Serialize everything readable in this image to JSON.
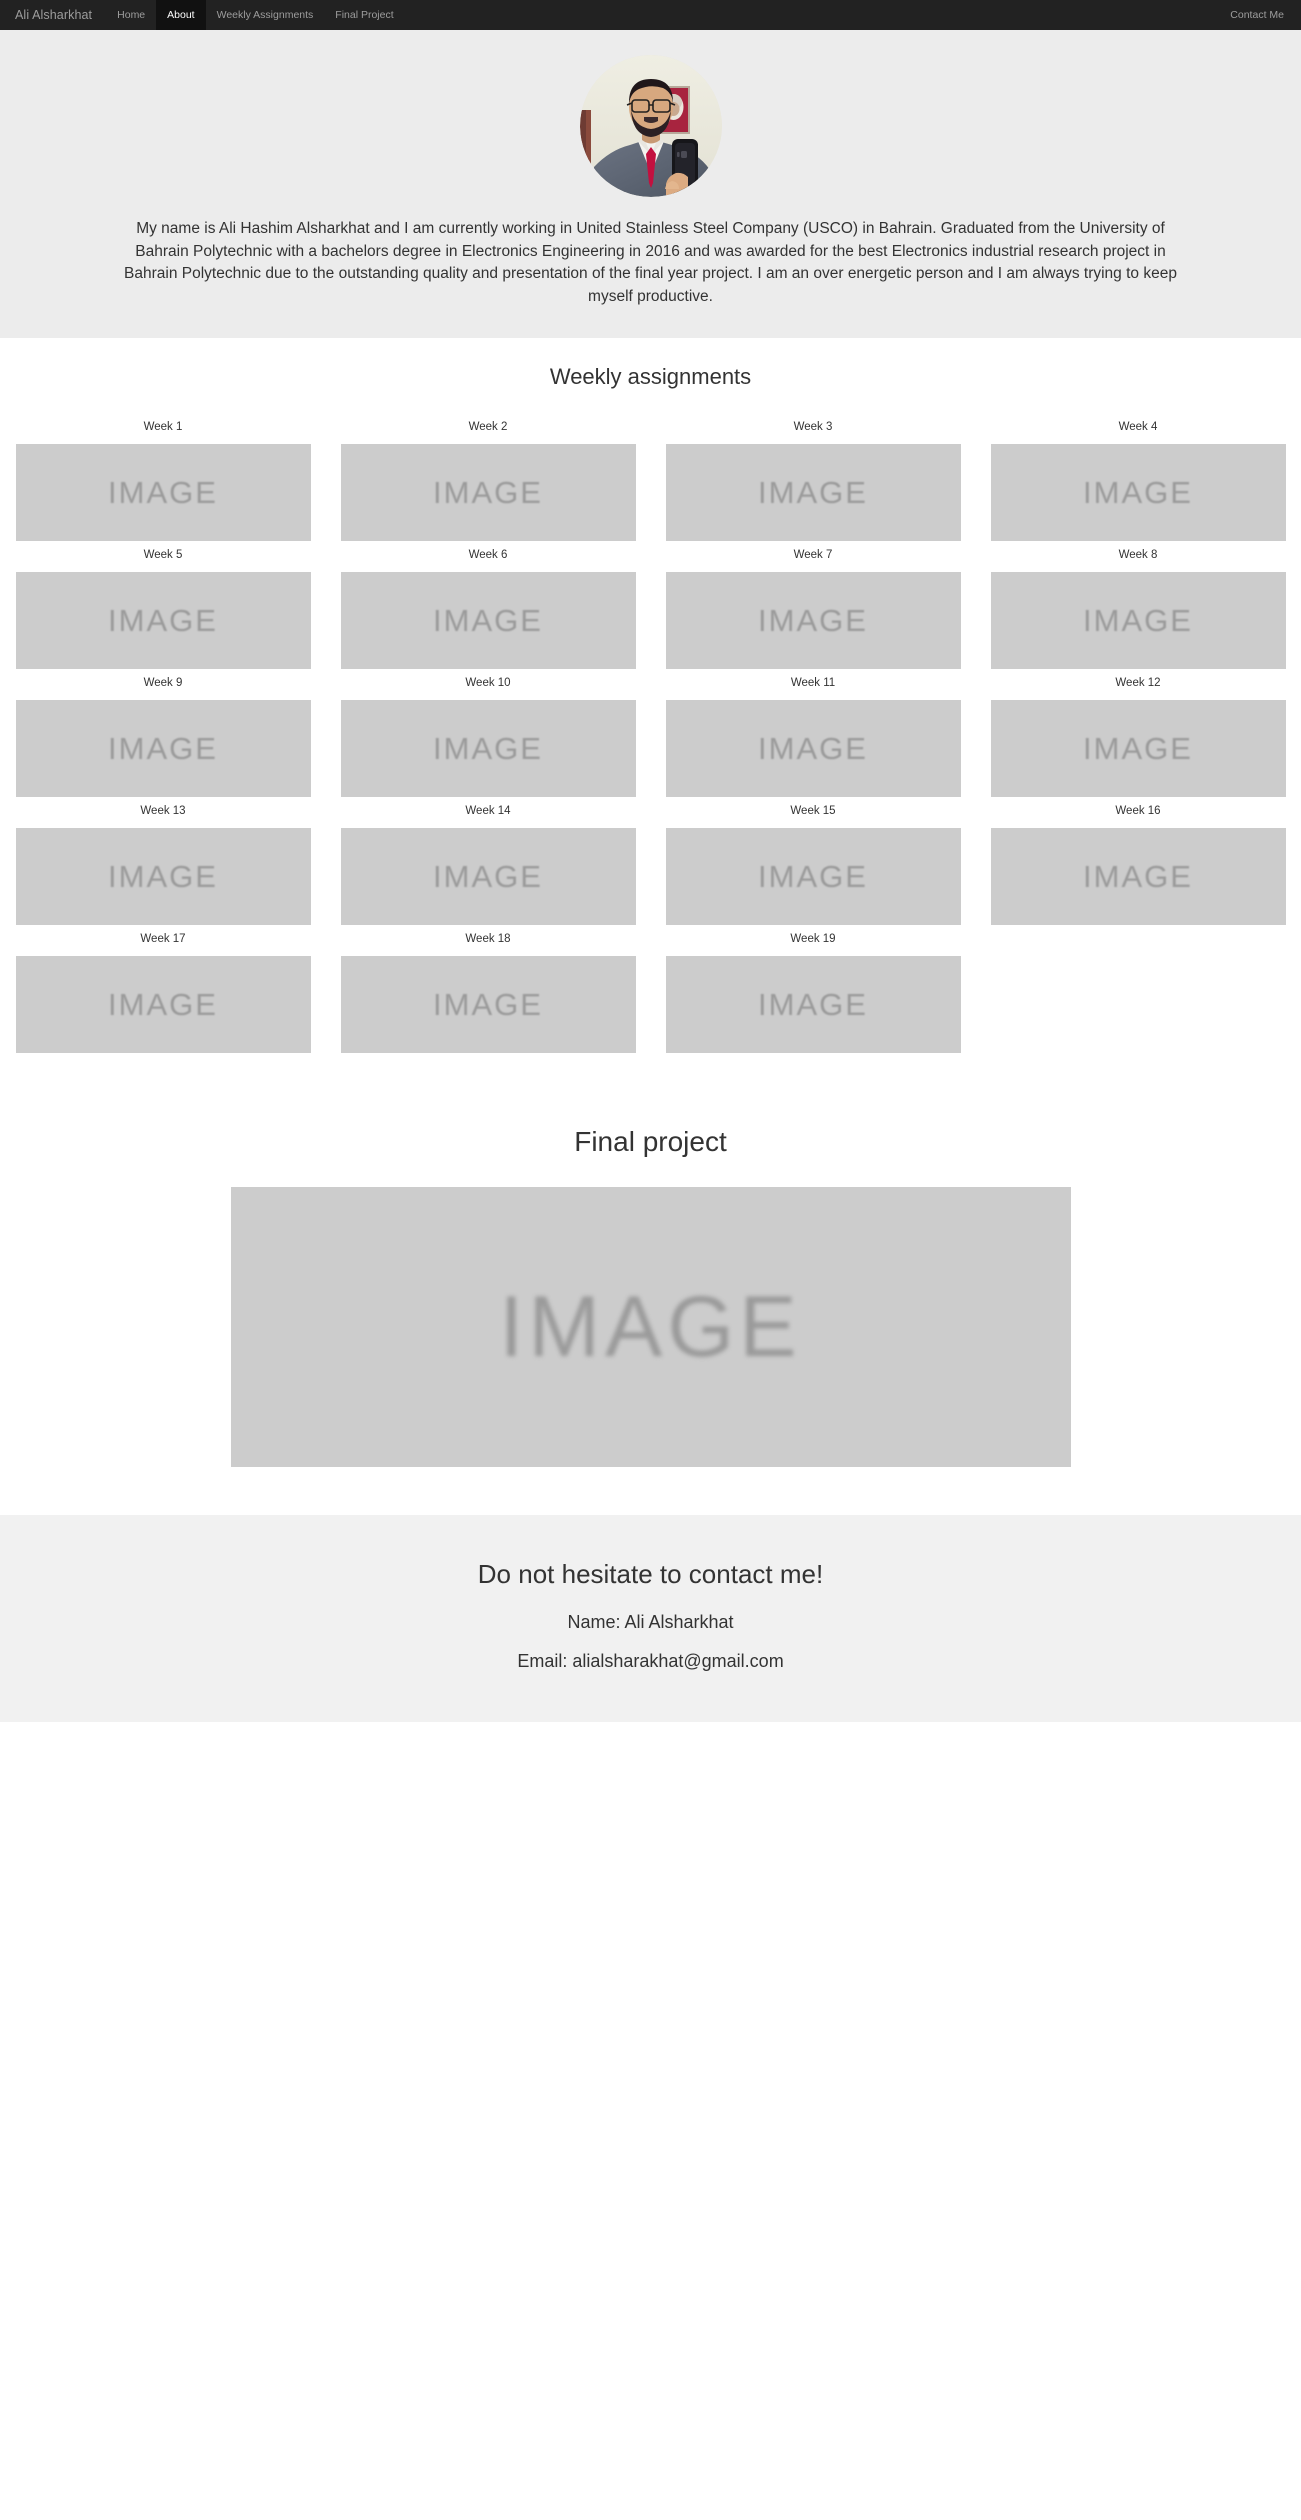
{
  "navbar": {
    "brand": "Ali Alsharkhat",
    "links": [
      {
        "label": "Home",
        "active": false
      },
      {
        "label": "About",
        "active": true
      },
      {
        "label": "Weekly Assignments",
        "active": false
      },
      {
        "label": "Final Project",
        "active": false
      }
    ],
    "right_links": [
      {
        "label": "Contact Me"
      }
    ],
    "background_color": "#222222",
    "active_background_color": "#111111",
    "link_color": "#9d9d9d"
  },
  "hero": {
    "background_color": "#ececec",
    "avatar_alt": "profile-photo",
    "paragraph": "My name is Ali Hashim Alsharkhat and I am currently working in United Stainless Steel Company (USCO) in Bahrain. Graduated from the University of Bahrain Polytechnic with a bachelors degree in Electronics Engineering in 2016 and was awarded for the best Electronics industrial research project in Bahrain Polytechnic due to the outstanding quality and presentation of the final year project. I am an over energetic person and I am always trying to keep myself productive."
  },
  "weekly": {
    "title": "Weekly assignments",
    "placeholder_text": "IMAGE",
    "placeholder_color": "#cccccc",
    "items": [
      {
        "caption": "Week 1"
      },
      {
        "caption": "Week 2"
      },
      {
        "caption": "Week 3"
      },
      {
        "caption": "Week 4"
      },
      {
        "caption": "Week 5"
      },
      {
        "caption": "Week 6"
      },
      {
        "caption": "Week 7"
      },
      {
        "caption": "Week 8"
      },
      {
        "caption": "Week 9"
      },
      {
        "caption": "Week 10"
      },
      {
        "caption": "Week 11"
      },
      {
        "caption": "Week 12"
      },
      {
        "caption": "Week 13"
      },
      {
        "caption": "Week 14"
      },
      {
        "caption": "Week 15"
      },
      {
        "caption": "Week 16"
      },
      {
        "caption": "Week 17"
      },
      {
        "caption": "Week 18"
      },
      {
        "caption": "Week 19"
      }
    ]
  },
  "final_project": {
    "title": "Final project",
    "placeholder_text": "IMAGE",
    "placeholder_color": "#cccccc"
  },
  "contact": {
    "background_color": "#f1f1f1",
    "title": "Do not hesitate to contact me!",
    "name_line": "Name: Ali Alsharkhat",
    "email_line": "Email: alialsharakhat@gmail.com"
  }
}
